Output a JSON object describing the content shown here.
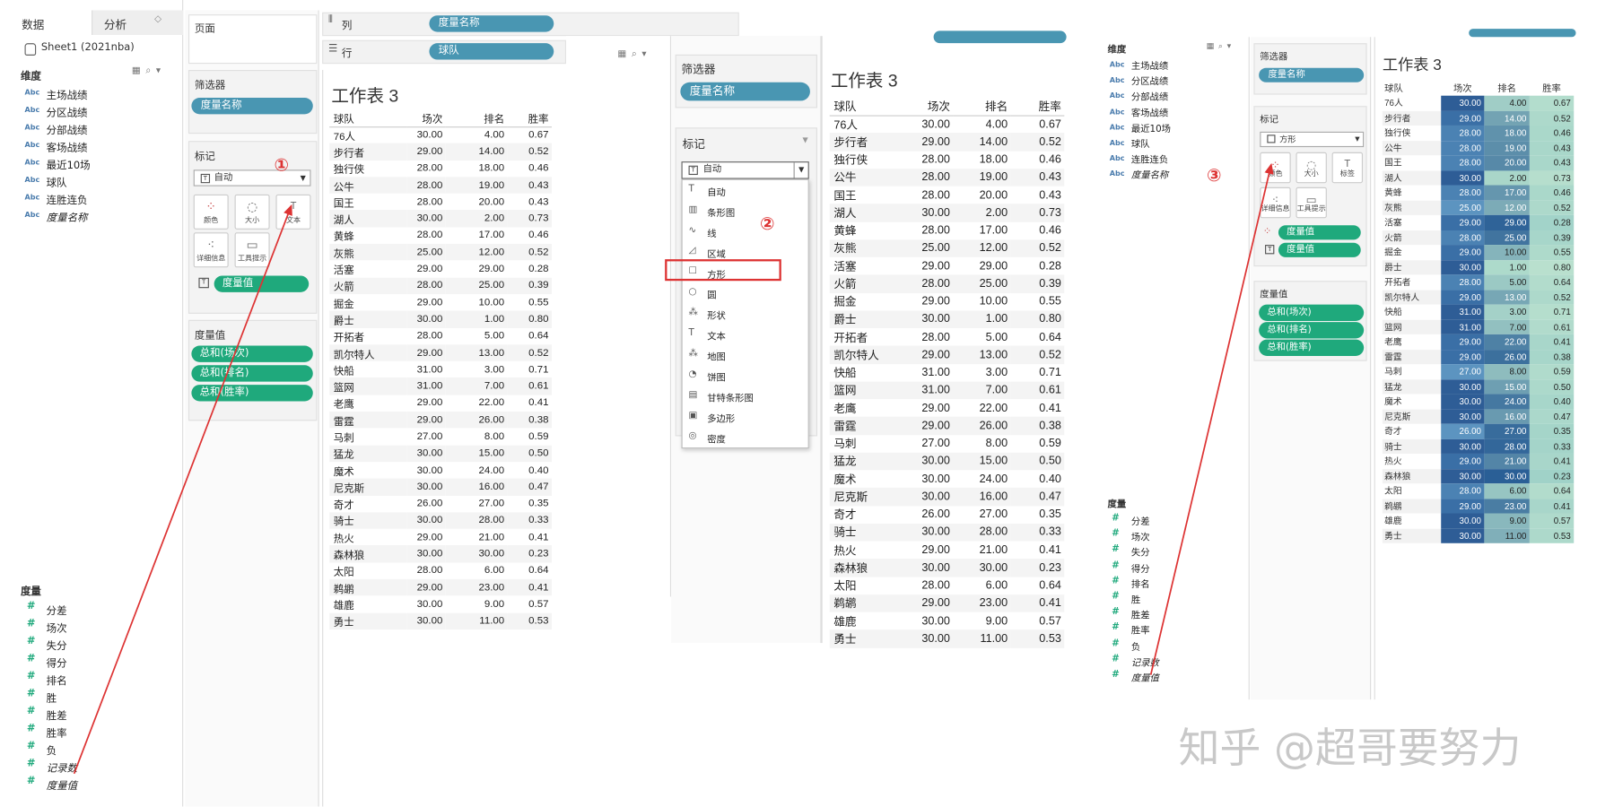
{
  "left_pane": {
    "tab_data": "数据",
    "tab_analysis": "分析",
    "datasource": "Sheet1 (2021nba)",
    "dimensions_header": "维度",
    "dimensions": [
      "主场战绩",
      "分区战绩",
      "分部战绩",
      "客场战绩",
      "最近10场",
      "球队",
      "连胜连负",
      "度量名称"
    ],
    "measures_header": "度量",
    "measures": [
      "分差",
      "场次",
      "失分",
      "得分",
      "排名",
      "胜",
      "胜差",
      "胜率",
      "负",
      "记录数",
      "度量值"
    ]
  },
  "shelves": {
    "pages": "页面",
    "filters": "筛选器",
    "filter_pill": "度量名称",
    "columns_label": "列",
    "columns_pill": "度量名称",
    "rows_label": "行",
    "rows_pill": "球队"
  },
  "marks": {
    "title": "标记",
    "type_auto": "自动",
    "type_square": "方形",
    "btn_color": "颜色",
    "btn_size": "大小",
    "btn_text": "文本",
    "btn_label": "标签",
    "btn_detail": "详细信息",
    "btn_tooltip": "工具提示",
    "text_pill": "度量值",
    "color_pill": "度量值"
  },
  "measure_values": {
    "title": "度量值",
    "items": [
      "总和(场次)",
      "总和(排名)",
      "总和(胜率)"
    ]
  },
  "dropdown": [
    "自动",
    "条形图",
    "线",
    "区域",
    "方形",
    "圆",
    "形状",
    "文本",
    "地图",
    "饼图",
    "甘特条形图",
    "多边形",
    "密度"
  ],
  "sheet": {
    "title": "工作表 3",
    "headers": [
      "球队",
      "场次",
      "排名",
      "胜率"
    ],
    "rows": [
      [
        "76人",
        "30.00",
        "4.00",
        "0.67"
      ],
      [
        "步行者",
        "29.00",
        "14.00",
        "0.52"
      ],
      [
        "独行侠",
        "28.00",
        "18.00",
        "0.46"
      ],
      [
        "公牛",
        "28.00",
        "19.00",
        "0.43"
      ],
      [
        "国王",
        "28.00",
        "20.00",
        "0.43"
      ],
      [
        "湖人",
        "30.00",
        "2.00",
        "0.73"
      ],
      [
        "黄蜂",
        "28.00",
        "17.00",
        "0.46"
      ],
      [
        "灰熊",
        "25.00",
        "12.00",
        "0.52"
      ],
      [
        "活塞",
        "29.00",
        "29.00",
        "0.28"
      ],
      [
        "火箭",
        "28.00",
        "25.00",
        "0.39"
      ],
      [
        "掘金",
        "29.00",
        "10.00",
        "0.55"
      ],
      [
        "爵士",
        "30.00",
        "1.00",
        "0.80"
      ],
      [
        "开拓者",
        "28.00",
        "5.00",
        "0.64"
      ],
      [
        "凯尔特人",
        "29.00",
        "13.00",
        "0.52"
      ],
      [
        "快船",
        "31.00",
        "3.00",
        "0.71"
      ],
      [
        "篮网",
        "31.00",
        "7.00",
        "0.61"
      ],
      [
        "老鹰",
        "29.00",
        "22.00",
        "0.41"
      ],
      [
        "雷霆",
        "29.00",
        "26.00",
        "0.38"
      ],
      [
        "马刺",
        "27.00",
        "8.00",
        "0.59"
      ],
      [
        "猛龙",
        "30.00",
        "15.00",
        "0.50"
      ],
      [
        "魔术",
        "30.00",
        "24.00",
        "0.40"
      ],
      [
        "尼克斯",
        "30.00",
        "16.00",
        "0.47"
      ],
      [
        "奇才",
        "26.00",
        "27.00",
        "0.35"
      ],
      [
        "骑士",
        "30.00",
        "28.00",
        "0.33"
      ],
      [
        "热火",
        "29.00",
        "21.00",
        "0.41"
      ],
      [
        "森林狼",
        "30.00",
        "30.00",
        "0.23"
      ],
      [
        "太阳",
        "28.00",
        "6.00",
        "0.64"
      ],
      [
        "鹈鹕",
        "29.00",
        "23.00",
        "0.41"
      ],
      [
        "雄鹿",
        "30.00",
        "9.00",
        "0.57"
      ],
      [
        "勇士",
        "30.00",
        "11.00",
        "0.53"
      ]
    ]
  },
  "step_labels": [
    "①",
    "②",
    "③"
  ],
  "watermark": "知乎 @超哥要努力",
  "colors": {
    "pill_blue": "#4996b2",
    "pill_green": "#1fa97c",
    "annotation_red": "#d33",
    "heat_dark": "#2f5f97",
    "heat_mid": "#4f8fba",
    "heat_light": "#b9dfcf"
  }
}
